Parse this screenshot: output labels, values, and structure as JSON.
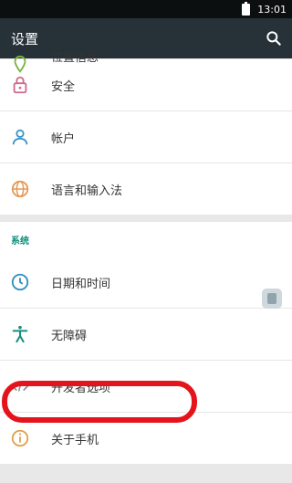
{
  "status": {
    "time": "13:01"
  },
  "appbar": {
    "title": "设置"
  },
  "items_top": [
    {
      "label": "位置信息",
      "icon": "location-icon"
    },
    {
      "label": "安全",
      "icon": "lock-icon"
    },
    {
      "label": "帐户",
      "icon": "account-icon"
    },
    {
      "label": "语言和输入法",
      "icon": "globe-icon"
    }
  ],
  "system": {
    "header": "系统",
    "items": [
      {
        "label": "日期和时间",
        "icon": "clock-icon"
      },
      {
        "label": "无障碍",
        "icon": "accessibility-icon"
      },
      {
        "label": "开发者选项",
        "icon": "code-icon"
      },
      {
        "label": "关于手机",
        "icon": "info-icon"
      }
    ]
  },
  "colors": {
    "appbar": "#263238",
    "statusbar": "#0b0f10",
    "accent": "#0b8c7a",
    "highlight": "#e3141c"
  }
}
